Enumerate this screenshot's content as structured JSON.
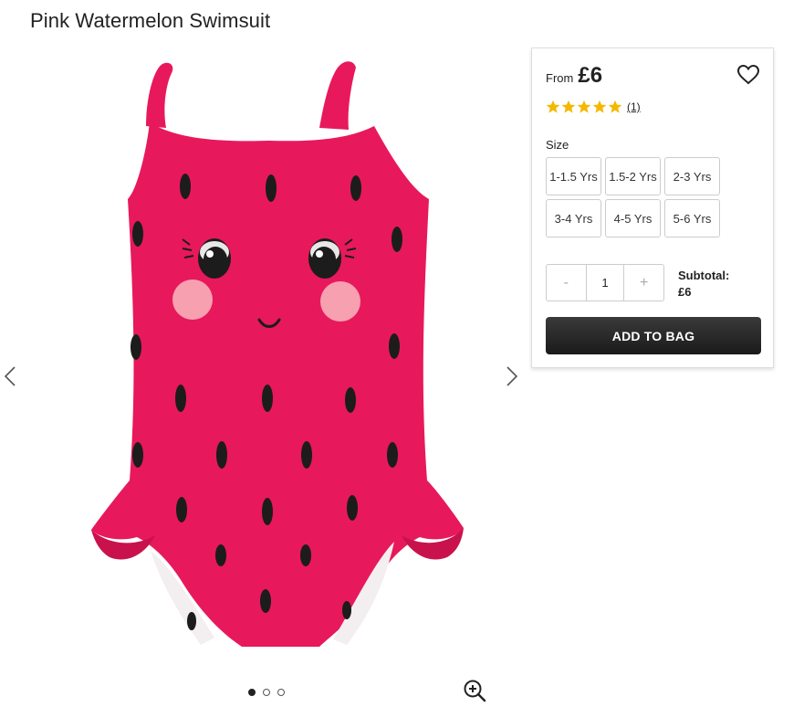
{
  "product": {
    "title": "Pink Watermelon Swimsuit",
    "colors": {
      "suit": "#e8185c",
      "seed": "#1c1c1c",
      "cheek": "#f6a0b0",
      "lining": "#f3eef0"
    }
  },
  "gallery": {
    "icons": {
      "prev": "chevron-left-icon",
      "next": "chevron-right-icon",
      "zoom": "zoom-in-icon"
    },
    "slides_total": 3,
    "active_slide": 1
  },
  "panel": {
    "from_label": "From",
    "price": "£6",
    "rating": {
      "stars": 5,
      "max": 5,
      "count": "(1)"
    },
    "star_color": "#f5b800",
    "size_label": "Size",
    "sizes": [
      "1-1.5 Yrs",
      "1.5-2 Yrs",
      "2-3 Yrs",
      "3-4 Yrs",
      "4-5 Yrs",
      "5-6 Yrs"
    ],
    "quantity": {
      "minus": "-",
      "value": "1",
      "plus": "+"
    },
    "subtotal_label": "Subtotal:",
    "subtotal_value": "£6",
    "add_to_bag": "ADD TO BAG"
  }
}
